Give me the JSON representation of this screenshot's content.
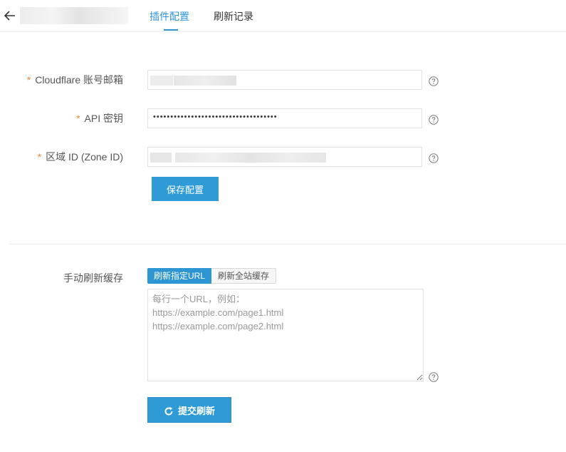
{
  "header": {
    "back_icon": "arrow-left-icon",
    "tabs": [
      {
        "label": "插件配置",
        "active": true
      },
      {
        "label": "刷新记录",
        "active": false
      }
    ]
  },
  "form": {
    "required_mark": "*",
    "email": {
      "label": "Cloudflare 账号邮箱"
    },
    "api_key": {
      "label": "API 密钥",
      "value": "••••••••••••••••••••••••••••••••••••"
    },
    "zone_id": {
      "label": "区域 ID (Zone ID)"
    },
    "save_label": "保存配置"
  },
  "manual": {
    "label": "手动刷新缓存",
    "segments": [
      {
        "label": "刷新指定URL",
        "active": true
      },
      {
        "label": "刷新全站缓存",
        "active": false
      }
    ],
    "placeholder": "每行一个URL，例如：\nhttps://example.com/page1.html\nhttps://example.com/page2.html",
    "submit_label": "提交刷新",
    "submit_icon": "refresh-icon"
  },
  "colors": {
    "accent": "#2e95d3",
    "required": "#f0883a"
  }
}
